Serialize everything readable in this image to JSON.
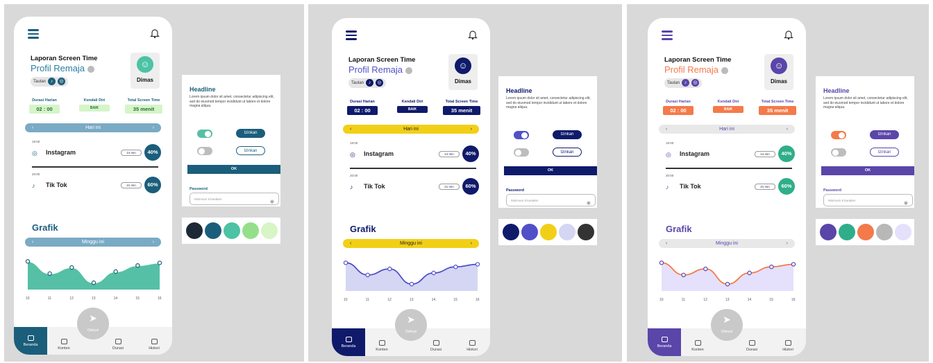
{
  "screens": [
    {
      "accent": "#1b5e7b",
      "name_color": "#1b5e7b",
      "sub_color": "#2a7ea0",
      "avatar_color": "#4dc2a5",
      "stat_value_bg": "#d5f5c9",
      "stat_value_color": "#2a6b3c",
      "bar_bg": "#7aaac4",
      "bar_color": "#fff",
      "pct_bg": "#1b5e7b",
      "chart_fill": "#55c0a5",
      "chart_line": "#ffffff",
      "chart_point": "#1b5e7b",
      "home_bg": "#1b5e7b",
      "toggle_on": "#55c0a5",
      "palette": [
        "#1d2a35",
        "#1b5e7b",
        "#4dc2a5",
        "#94e08a",
        "#d8f5c5"
      ]
    },
    {
      "accent": "#0f1a6b",
      "name_color": "#0f1a6b",
      "sub_color": "#5150c8",
      "avatar_color": "#0f1a6b",
      "stat_value_bg": "#0f1a6b",
      "stat_value_color": "#fff",
      "bar_bg": "#f2cf17",
      "bar_color": "#1d1d1d",
      "pct_bg": "#0f1a6b",
      "chart_fill": "#d4d6f3",
      "chart_line": "#5150c8",
      "chart_point": "#5150c8",
      "home_bg": "#0f1a6b",
      "toggle_on": "#5150c8",
      "palette": [
        "#0f1a6b",
        "#5150c8",
        "#f2cf17",
        "#d4d6f3",
        "#333333"
      ]
    },
    {
      "accent": "#5a45a9",
      "name_color": "#5a45a9",
      "sub_color": "#f47a4a",
      "avatar_color": "#5a45a9",
      "stat_value_bg": "#f47a4a",
      "stat_value_color": "#fff",
      "bar_bg": "#e8e8e8",
      "bar_color": "#5a45a9",
      "pct_bg": "#2fae8a",
      "chart_fill": "#e5e0fb",
      "chart_line": "#f47a4a",
      "chart_point": "#5a45a9",
      "home_bg": "#5a45a9",
      "toggle_on": "#f47a4a",
      "palette": [
        "#5a45a9",
        "#2fae8a",
        "#f47a4a",
        "#b8b8b8",
        "#e5e0fb"
      ]
    }
  ],
  "ui": {
    "title": "Laporan Screen Time",
    "subtitle": "Profil Remaja",
    "tag_label": "Tautan",
    "profile_name": "Dimas",
    "stat_durasi_label": "Durasi Harian",
    "stat_durasi_value": "02 : 00",
    "stat_kendali_label": "Kendali Diri",
    "stat_kendali_value": "BAIK",
    "stat_total_label": "Total Screen Time",
    "stat_total_value": "35 menit",
    "day_label": "Hari ini",
    "app1_time": "19:00",
    "app1_name": "Instagram",
    "app1_minutes": "14 min",
    "app1_pct": "40%",
    "app2_time": "20:00",
    "app2_name": "Tik Tok",
    "app2_minutes": "21 min",
    "app2_pct": "60%",
    "graph_title": "Grafik",
    "week_label": "Minggu ini",
    "nav_beranda": "Beranda",
    "nav_konten": "Konten",
    "nav_durasi": "Durasi",
    "nav_histori": "Histori",
    "fab_label": "Diskusi",
    "card_headline": "Headline",
    "card_lorem": "Lorem ipsum dolor sit amet, consectetur adipiscing elit, sed do eiusmod tempor incididunt ut labore et dolore magna aliqua.",
    "izinkan": "Izinkan",
    "ok": "OK",
    "password_label": "Password",
    "password_placeholder": "Minimum 8 karakter"
  },
  "chart_data": {
    "type": "area",
    "x": [
      "10",
      "11",
      "12",
      "13",
      "14",
      "15",
      "16"
    ],
    "values": [
      5,
      2.6,
      3.8,
      0.8,
      3,
      4.2,
      4.7
    ],
    "ylim": [
      0,
      6
    ]
  }
}
